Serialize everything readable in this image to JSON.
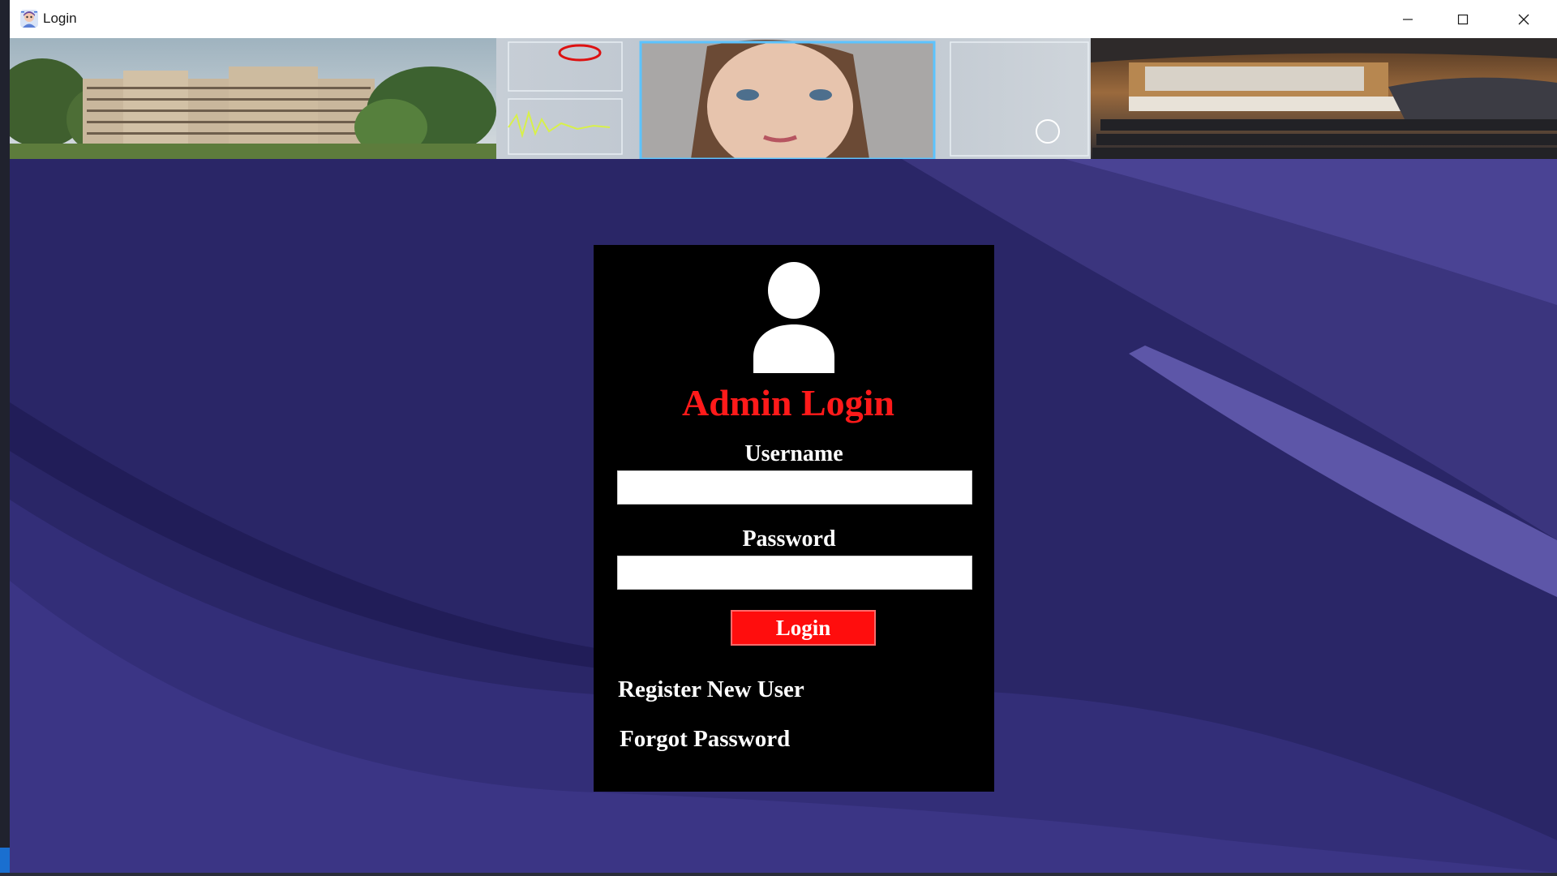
{
  "window": {
    "title": "Login",
    "controls": {
      "minimize": "minimize-icon",
      "maximize": "maximize-icon",
      "close": "close-icon"
    }
  },
  "banner": {
    "panels": [
      "campus-building-photo",
      "face-recognition-photo",
      "auditorium-photo"
    ]
  },
  "login_panel": {
    "icon": "user-icon",
    "title": "Admin Login",
    "username_label": "Username",
    "username_value": "",
    "password_label": "Password",
    "password_value": "",
    "login_button": "Login",
    "register_link": "Register New User",
    "forgot_link": "Forgot Password"
  },
  "colors": {
    "background": "#241f5e",
    "panel": "#000000",
    "title": "#ff1a1a",
    "button": "#ff0d0d",
    "text": "#ffffff"
  }
}
